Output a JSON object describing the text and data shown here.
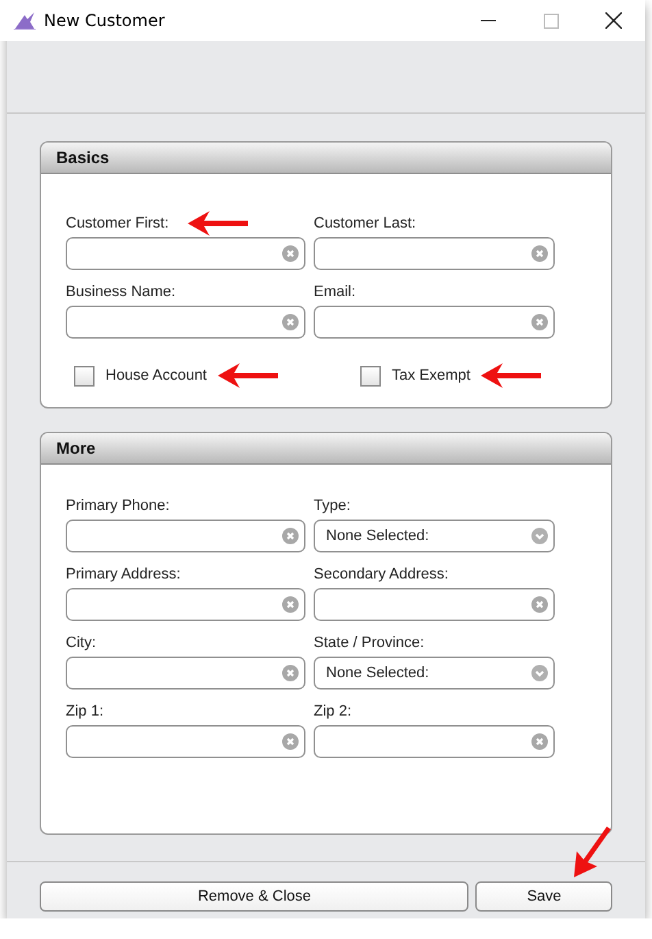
{
  "window": {
    "title": "New Customer"
  },
  "sections": [
    {
      "title": "Basics",
      "fields": [
        {
          "kind": "text",
          "label": "Customer First:",
          "marked": true
        },
        {
          "kind": "text",
          "label": "Customer Last:",
          "marked": false
        },
        {
          "kind": "text",
          "label": "Business Name:",
          "marked": false
        },
        {
          "kind": "text",
          "label": "Email:",
          "marked": false
        }
      ],
      "checkboxes": [
        {
          "label": "House Account",
          "checked": false,
          "marked": true
        },
        {
          "label": "Tax Exempt",
          "checked": false,
          "marked": true
        }
      ]
    },
    {
      "title": "More",
      "fields": [
        {
          "kind": "text",
          "label": "Primary Phone:",
          "marked": false
        },
        {
          "kind": "select",
          "label": "Type:",
          "value": "None Selected:",
          "marked": false
        },
        {
          "kind": "text",
          "label": "Primary Address:",
          "marked": false
        },
        {
          "kind": "text",
          "label": "Secondary Address:",
          "marked": false
        },
        {
          "kind": "text",
          "label": "City:",
          "marked": false
        },
        {
          "kind": "select",
          "label": "State / Province:",
          "value": "None Selected:",
          "marked": false
        },
        {
          "kind": "text",
          "label": "Zip 1:",
          "marked": false
        },
        {
          "kind": "text",
          "label": "Zip 2:",
          "marked": false
        }
      ]
    }
  ],
  "buttons": [
    {
      "label": "Remove & Close",
      "marked": false
    },
    {
      "label": "Save",
      "marked": true
    }
  ]
}
